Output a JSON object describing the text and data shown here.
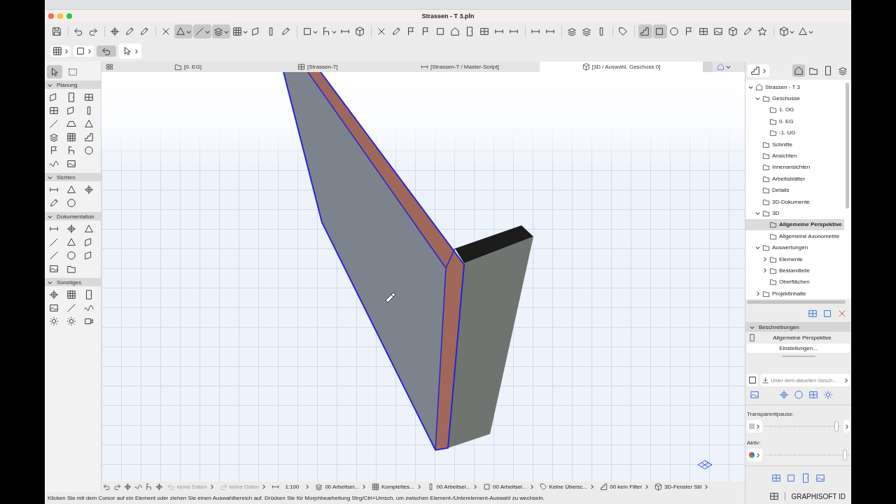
{
  "window": {
    "title": "Strassen - T 3.pln"
  },
  "toolbar": [
    {
      "pressed": false
    },
    {
      "pressed": false
    },
    {
      "pressed": false
    },
    {
      "pressed": false
    },
    {
      "pressed": false
    },
    {
      "pressed": false
    },
    {
      "pressed": false
    },
    {
      "pressed": true
    },
    {
      "pressed": true
    },
    {
      "pressed": true
    },
    {
      "pressed": false
    },
    {
      "pressed": false
    },
    {
      "pressed": false
    },
    {
      "pressed": false
    },
    {
      "pressed": false
    },
    {
      "pressed": false
    },
    {
      "pressed": false
    },
    {
      "pressed": false
    },
    {
      "pressed": false
    },
    {
      "pressed": false
    },
    {
      "pressed": false
    },
    {
      "pressed": false
    },
    {
      "pressed": false
    },
    {
      "pressed": false
    },
    {
      "pressed": false
    },
    {
      "pressed": false
    },
    {
      "pressed": false
    },
    {
      "pressed": false
    },
    {
      "pressed": false
    },
    {
      "pressed": false
    },
    {
      "pressed": false
    },
    {
      "pressed": false
    },
    {
      "pressed": false
    },
    {
      "pressed": false
    },
    {
      "pressed": true
    },
    {
      "pressed": true
    },
    {
      "pressed": false
    },
    {
      "pressed": false
    },
    {
      "pressed": false
    },
    {
      "pressed": false
    },
    {
      "pressed": false
    },
    {
      "pressed": false
    },
    {
      "pressed": false
    },
    {
      "pressed": false
    },
    {
      "pressed": false
    }
  ],
  "info_box": [
    {
      "pressed": false
    },
    {
      "pressed": false
    },
    {
      "pressed": true
    },
    {
      "pressed": false
    }
  ],
  "tabs": [
    {
      "label": "[0. EG]",
      "selected": false
    },
    {
      "label": "[Strassen-T]",
      "selected": false
    },
    {
      "label": "[Strassen-T / Master-Script]",
      "selected": false
    },
    {
      "label": "[3D / Auswahl, Geschoss 0]",
      "selected": true
    }
  ],
  "toolbox": {
    "pointer_tools": [
      {
        "selected": true
      },
      {
        "selected": false
      }
    ],
    "sections": [
      {
        "label": "Planung",
        "expanded": true
      },
      {
        "label": "Sichten",
        "expanded": true
      },
      {
        "label": "Dokumentation",
        "expanded": true
      },
      {
        "label": "Sonstiges",
        "expanded": true
      }
    ]
  },
  "navigator": {
    "views": [
      {
        "selected": true
      },
      {
        "selected": false
      },
      {
        "selected": false
      },
      {
        "selected": false
      }
    ],
    "items": [
      {
        "label": "Strassen - T 3",
        "selected": false,
        "expanded": true,
        "children": [
          {
            "label": "Geschosse",
            "selected": false,
            "expanded": true,
            "children": [
              {
                "label": "1. OG",
                "selected": false
              },
              {
                "label": "0. EG",
                "selected": false
              },
              {
                "label": "-1. UG",
                "selected": false
              }
            ]
          },
          {
            "label": "Schnitte",
            "selected": false
          },
          {
            "label": "Ansichten",
            "selected": false
          },
          {
            "label": "Innenansichten",
            "selected": false
          },
          {
            "label": "Arbeitsblätter",
            "selected": false
          },
          {
            "label": "Details",
            "selected": false
          },
          {
            "label": "3D-Dokumente",
            "selected": false
          },
          {
            "label": "3D",
            "selected": false,
            "expanded": true,
            "children": [
              {
                "label": "Allgemeine Perspektive",
                "selected": true
              },
              {
                "label": "Allgemeine Axonometrie",
                "selected": false
              }
            ]
          },
          {
            "label": "Auswertungen",
            "selected": false,
            "expanded": true,
            "children": [
              {
                "label": "Elemente",
                "selected": false,
                "expanded": false
              },
              {
                "label": "Bestandteile",
                "selected": false,
                "expanded": false
              },
              {
                "label": "Oberflächen",
                "selected": false
              }
            ]
          },
          {
            "label": "Projektinhalte",
            "selected": false,
            "expanded": false
          }
        ]
      }
    ]
  },
  "properties": {
    "section": {
      "label": "Beschreibungen",
      "expanded": true
    },
    "view_name": "Allgemeine Perspektive",
    "settings_button": "Einstellungen...",
    "placement_field": {
      "value": "Unter dem aktuellen Gesch..."
    },
    "trace": {
      "label": "Transparentpause:",
      "level": 0.97
    },
    "active": {
      "label": "Aktiv:",
      "level": 0.97
    },
    "footer": "GRAPHISOFT ID"
  },
  "status_bar": {
    "items": [
      {
        "text": "keine Daten",
        "disabled": true
      },
      {
        "text": "keine Daten",
        "disabled": true
      },
      {
        "text": "1:100",
        "disabled": false
      },
      {
        "text": "00 Arbeitsei...",
        "disabled": false
      },
      {
        "text": "Komplettes...",
        "disabled": false
      },
      {
        "text": "00 Arbeitsei...",
        "disabled": false
      },
      {
        "text": "00 Arbeitsei...",
        "disabled": false
      },
      {
        "text": "Keine Übersc...",
        "disabled": false
      },
      {
        "text": "00 kein Filter",
        "disabled": false
      },
      {
        "text": "3D-Fenster Stil",
        "disabled": false
      }
    ],
    "message": "Klicken Sie mit dem Cursor auf ein Element oder ziehen Sie einen Auswahlbereich auf. Drücken Sie für Morphbearbeitung Strg/Ctrl+Umsch, um zwischen Element-/Unterelement-Auswahl zu wechseln."
  }
}
